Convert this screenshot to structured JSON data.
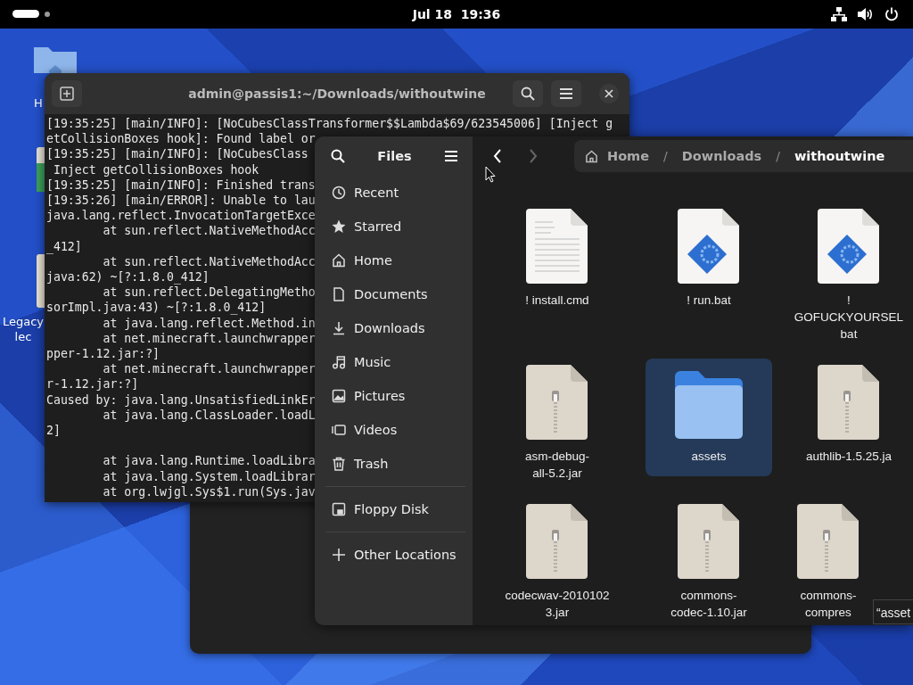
{
  "top_bar": {
    "clock": "Jul 18  19:36"
  },
  "desktop_icons": [
    {
      "label": [
        "H"
      ]
    },
    {
      "label": [
        "Legacy",
        "lec"
      ]
    }
  ],
  "terminal": {
    "title": "admin@passis1:~/Downloads/withoutwine",
    "lines": [
      {
        "text": "[19:35:25] [main/INFO]: [NoCubesClassTransformer$$Lambda$69/623545006] [Inject g"
      },
      {
        "text": "etCollisionBoxes hook]: Found label or"
      },
      {
        "text": "[19:35:25] [main/INFO]: [NoCubesClass"
      },
      {
        "text": " Inject getCollisionBoxes hook"
      },
      {
        "text": "[19:35:25] [main/INFO]: Finished trans"
      },
      {
        "text": "[19:35:26] [main/ERROR]: Unable to lau"
      },
      {
        "text": "java.lang.reflect.InvocationTargetExce"
      },
      {
        "text": "        at sun.reflect.NativeMethodAcc"
      },
      {
        "text": "_412]"
      },
      {
        "text": "        at sun.reflect.NativeMethodAcc"
      },
      {
        "text": "java:62) ~[?:1.8.0_412]"
      },
      {
        "text": "        at sun.reflect.DelegatingMetho"
      },
      {
        "text": "sorImpl.java:43) ~[?:1.8.0_412]"
      },
      {
        "text": "        at java.lang.reflect.Method.in"
      },
      {
        "text": "        at net.minecraft.launchwrapper"
      },
      {
        "text": "pper-1.12.jar:?]"
      },
      {
        "text": "        at net.minecraft.launchwrapper"
      },
      {
        "text": "r-1.12.jar:?]"
      },
      {
        "text": "Caused by: java.lang.UnsatisfiedLinkEr"
      },
      {
        "text": "        at java.lang.ClassLoader.loadL"
      },
      {
        "text": "2]"
      },
      {
        "text": "        at java.lang.Runtime.loadLibra",
        "gap_before": true
      },
      {
        "text": "        at java.lang.System.loadLibrar"
      },
      {
        "text": "        at org.lwjgl.Sys$1.run(Sys.jav"
      }
    ]
  },
  "files": {
    "title": "Files",
    "sidebar": [
      {
        "label": "Recent",
        "selected": false
      },
      {
        "label": "Starred",
        "selected": false
      },
      {
        "label": "Home",
        "selected": false
      },
      {
        "label": "Documents",
        "selected": false
      },
      {
        "label": "Downloads",
        "selected": false
      },
      {
        "label": "Music",
        "selected": false
      },
      {
        "label": "Pictures",
        "selected": false
      },
      {
        "label": "Videos",
        "selected": false
      },
      {
        "label": "Trash",
        "selected": false
      }
    ],
    "devices": [
      {
        "label": "Floppy Disk",
        "selected": false
      }
    ],
    "other": [
      {
        "label": "Other Locations",
        "selected": false
      }
    ],
    "breadcrumb": [
      {
        "label": "Home"
      },
      {
        "separator": "/",
        "label": "Downloads"
      },
      {
        "separator": "/",
        "label": "withoutwine"
      }
    ],
    "items": [
      {
        "kind": "text",
        "label": [
          "! install.cmd"
        ],
        "selected": false
      },
      {
        "kind": "script",
        "label": [
          "! run.bat"
        ],
        "selected": false
      },
      {
        "kind": "script",
        "label": [
          "!",
          "GOFUCKYOURSEL",
          "bat"
        ],
        "selected": false
      },
      {
        "kind": "archive",
        "label": [
          "asm-debug-",
          "all-5.2.jar"
        ],
        "selected": false
      },
      {
        "kind": "folder",
        "label": [
          "assets"
        ],
        "selected": true
      },
      {
        "kind": "archive",
        "label": [
          "authlib-1.5.25.ja"
        ],
        "selected": false
      },
      {
        "kind": "archive",
        "label": [
          "codecwav-2010102",
          "3.jar"
        ],
        "selected": false
      },
      {
        "kind": "archive",
        "label": [
          "commons-",
          "codec-1.10.jar"
        ],
        "selected": false
      },
      {
        "kind": "archive",
        "label": [
          "commons-",
          "compres"
        ],
        "selected": false
      }
    ],
    "tooltip": "“asset"
  }
}
